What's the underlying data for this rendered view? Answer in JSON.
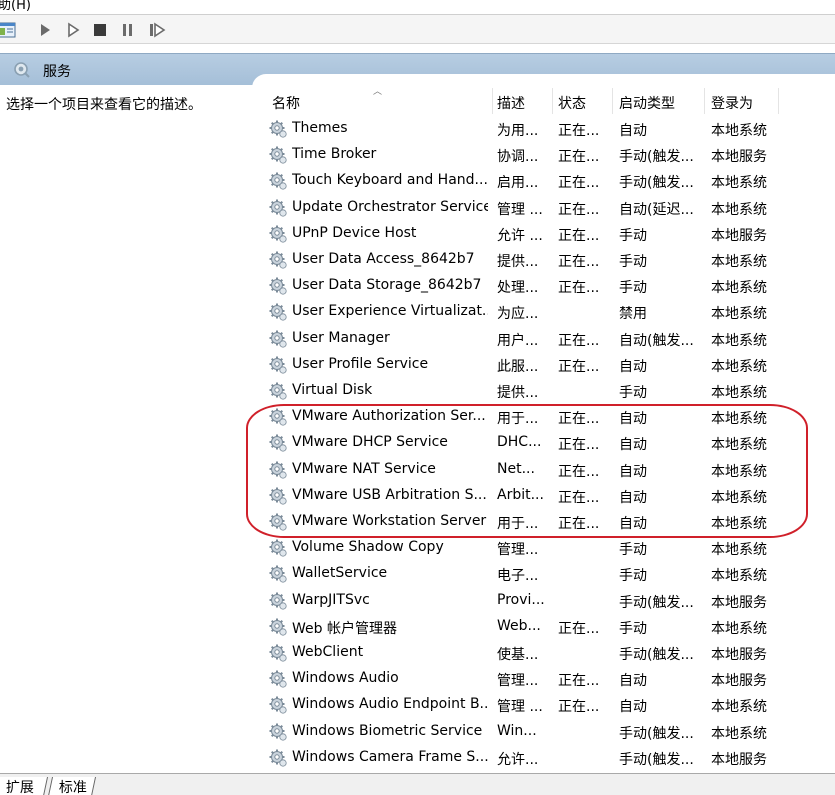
{
  "menubar": {
    "partial_text": "助(H)"
  },
  "toolbar": {
    "buttons": [
      {
        "name": "console-view-button",
        "icon": "console-icon"
      },
      {
        "name": "start-service-button",
        "icon": "play-icon"
      },
      {
        "name": "start-service-alt-button",
        "icon": "play-outline-icon"
      },
      {
        "name": "stop-service-button",
        "icon": "stop-icon"
      },
      {
        "name": "pause-service-button",
        "icon": "pause-icon"
      },
      {
        "name": "restart-service-button",
        "icon": "restart-icon"
      }
    ]
  },
  "header": {
    "title": "服务",
    "icon": "services-icon"
  },
  "left_pane": {
    "description": "选择一个项目来查看它的描述。"
  },
  "table": {
    "columns": [
      "名称",
      "描述",
      "状态",
      "启动类型",
      "登录为"
    ],
    "rows": [
      {
        "name": "Themes",
        "desc": "为用...",
        "status": "正在...",
        "startup": "自动",
        "logon": "本地系统"
      },
      {
        "name": "Time Broker",
        "desc": "协调...",
        "status": "正在...",
        "startup": "手动(触发...",
        "logon": "本地服务"
      },
      {
        "name": "Touch Keyboard and Hand...",
        "desc": "启用...",
        "status": "正在...",
        "startup": "手动(触发...",
        "logon": "本地系统"
      },
      {
        "name": "Update Orchestrator Service",
        "desc": "管理 ...",
        "status": "正在...",
        "startup": "自动(延迟...",
        "logon": "本地系统"
      },
      {
        "name": "UPnP Device Host",
        "desc": "允许 ...",
        "status": "正在...",
        "startup": "手动",
        "logon": "本地服务"
      },
      {
        "name": "User Data Access_8642b7",
        "desc": "提供...",
        "status": "正在...",
        "startup": "手动",
        "logon": "本地系统"
      },
      {
        "name": "User Data Storage_8642b7",
        "desc": "处理...",
        "status": "正在...",
        "startup": "手动",
        "logon": "本地系统"
      },
      {
        "name": "User Experience Virtualizat...",
        "desc": "为应...",
        "status": "",
        "startup": "禁用",
        "logon": "本地系统"
      },
      {
        "name": "User Manager",
        "desc": "用户...",
        "status": "正在...",
        "startup": "自动(触发...",
        "logon": "本地系统"
      },
      {
        "name": "User Profile Service",
        "desc": "此服...",
        "status": "正在...",
        "startup": "自动",
        "logon": "本地系统"
      },
      {
        "name": "Virtual Disk",
        "desc": "提供...",
        "status": "",
        "startup": "手动",
        "logon": "本地系统"
      },
      {
        "name": "VMware Authorization Ser...",
        "desc": "用于...",
        "status": "正在...",
        "startup": "自动",
        "logon": "本地系统"
      },
      {
        "name": "VMware DHCP Service",
        "desc": "DHC...",
        "status": "正在...",
        "startup": "自动",
        "logon": "本地系统"
      },
      {
        "name": "VMware NAT Service",
        "desc": "Net...",
        "status": "正在...",
        "startup": "自动",
        "logon": "本地系统"
      },
      {
        "name": "VMware USB Arbitration S...",
        "desc": "Arbit...",
        "status": "正在...",
        "startup": "自动",
        "logon": "本地系统"
      },
      {
        "name": "VMware Workstation Server",
        "desc": "用于...",
        "status": "正在...",
        "startup": "自动",
        "logon": "本地系统"
      },
      {
        "name": "Volume Shadow Copy",
        "desc": "管理...",
        "status": "",
        "startup": "手动",
        "logon": "本地系统"
      },
      {
        "name": "WalletService",
        "desc": "电子...",
        "status": "",
        "startup": "手动",
        "logon": "本地系统"
      },
      {
        "name": "WarpJITSvc",
        "desc": "Provi...",
        "status": "",
        "startup": "手动(触发...",
        "logon": "本地服务"
      },
      {
        "name": "Web 帐户管理器",
        "desc": "Web...",
        "status": "正在...",
        "startup": "手动",
        "logon": "本地系统"
      },
      {
        "name": "WebClient",
        "desc": "使基...",
        "status": "",
        "startup": "手动(触发...",
        "logon": "本地服务"
      },
      {
        "name": "Windows Audio",
        "desc": "管理...",
        "status": "正在...",
        "startup": "自动",
        "logon": "本地服务"
      },
      {
        "name": "Windows Audio Endpoint B...",
        "desc": "管理 ...",
        "status": "正在...",
        "startup": "自动",
        "logon": "本地系统"
      },
      {
        "name": "Windows Biometric Service",
        "desc": "Win...",
        "status": "",
        "startup": "手动(触发...",
        "logon": "本地系统"
      },
      {
        "name": "Windows Camera Frame S...",
        "desc": "允许...",
        "status": "",
        "startup": "手动(触发...",
        "logon": "本地服务"
      }
    ]
  },
  "annotation": {
    "color": "#d0202a"
  },
  "bottom_tabs": [
    "扩展",
    "标准"
  ]
}
